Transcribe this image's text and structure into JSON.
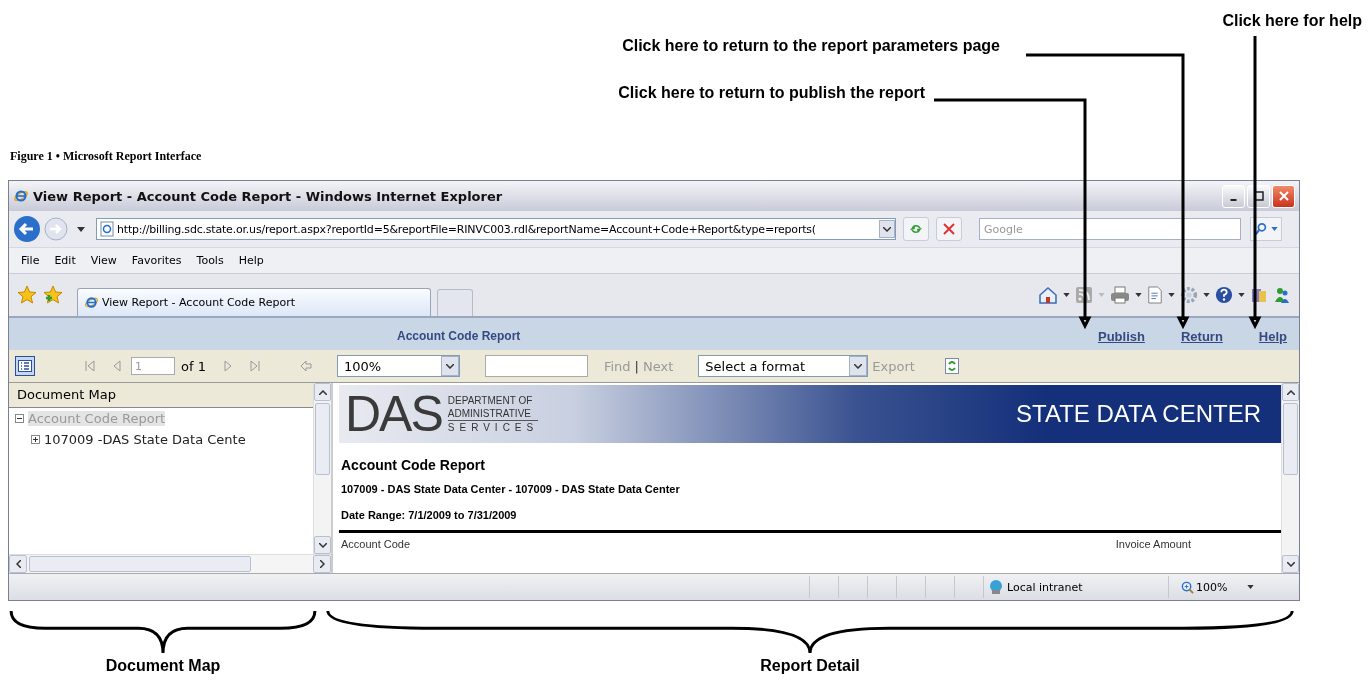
{
  "callouts": [
    {
      "text": "Click here for help"
    },
    {
      "text": "Click here to return to the report parameters page"
    },
    {
      "text": "Click here to return to publish the report"
    }
  ],
  "figure_caption": "Figure 1 • Microsoft Report Interface",
  "window": {
    "title": "View Report - Account Code Report - Windows Internet Explorer",
    "address": "http://billing.sdc.state.or.us/report.aspx?reportId=5&reportFile=RINVC003.rdl&reportName=Account+Code+Report&type=reports(",
    "search_placeholder": "Google",
    "menu": [
      "File",
      "Edit",
      "View",
      "Favorites",
      "Tools",
      "Help"
    ],
    "tabs": [
      {
        "label": "View Report - Account Code Report",
        "selected": true
      }
    ]
  },
  "report_viewer": {
    "title": "Account Code Report",
    "links": [
      "Publish",
      "Return",
      "Help"
    ],
    "toolbar": {
      "page": "1",
      "page_of": "of 1",
      "zoom": "100%",
      "find": "Find",
      "separator": "|",
      "next": "Next",
      "format": "Select a format",
      "export": "Export"
    }
  },
  "document_map": {
    "title": "Document Map",
    "tree": [
      {
        "label": "Account Code Report",
        "expanded": true,
        "selected": true,
        "children": [
          {
            "label": "107009 -DAS State Data Cente",
            "expanded": false,
            "selected": false
          }
        ]
      }
    ]
  },
  "report": {
    "logo": "DAS",
    "department": [
      "DEPARTMENT OF",
      "ADMINISTRATIVE",
      "SERVICES"
    ],
    "banner_title": "STATE DATA CENTER",
    "heading": "Account Code Report",
    "subheading": "107009 - DAS State Data Center - 107009 - DAS State Data Center",
    "date_range": "Date Range: 7/1/2009 to 7/31/2009",
    "columns": [
      "Account Code",
      "Invoice Amount"
    ]
  },
  "status_bar": {
    "zone": "Local intranet",
    "zoom": "100%"
  },
  "braces": [
    {
      "label": "Document Map"
    },
    {
      "label": "Report Detail"
    }
  ]
}
